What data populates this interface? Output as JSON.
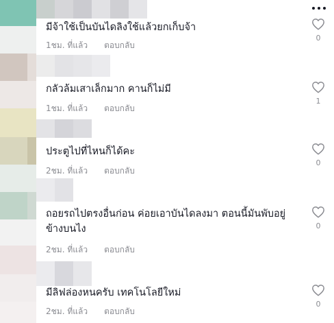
{
  "header": {
    "more_icon": "more-horizontal-icon"
  },
  "comments": [
    {
      "text": "มีจ้าใช้เป็นบันไดลิงใช้แล้วยกเก็บจ้า",
      "time": "1ชม. ที่แล้ว",
      "reply_label": "ตอบกลับ",
      "likes": "0"
    },
    {
      "text": "กลัวล้มเสาเล็กมาก คานก็ไม่มี",
      "time": "1ชม. ที่แล้ว",
      "reply_label": "ตอบกลับ",
      "likes": "1"
    },
    {
      "text": "ประตูไปที่ไหนก็ได้คะ",
      "time": "2ชม. ที่แล้ว",
      "reply_label": "ตอบกลับ",
      "likes": "0"
    },
    {
      "text": "ถอยรถไปตรงอื่นก่อน ค่อยเอาบันไดลงมา ตอนนี้มันพับอยู่\nข้างบนไง",
      "time": "2ชม. ที่แล้ว",
      "reply_label": "ตอบกลับ",
      "likes": "0"
    },
    {
      "text": "มีลิฟล่องหนครับ เทคโนโลยีใหม่",
      "time": "2ชม. ที่แล้ว",
      "reply_label": "ตอบกลับ",
      "likes": "0"
    }
  ],
  "icons": {
    "like": "heart-outline-icon"
  },
  "colors": {
    "text_primary": "#161823",
    "text_secondary": "#8a8b91",
    "background": "#ffffff"
  }
}
